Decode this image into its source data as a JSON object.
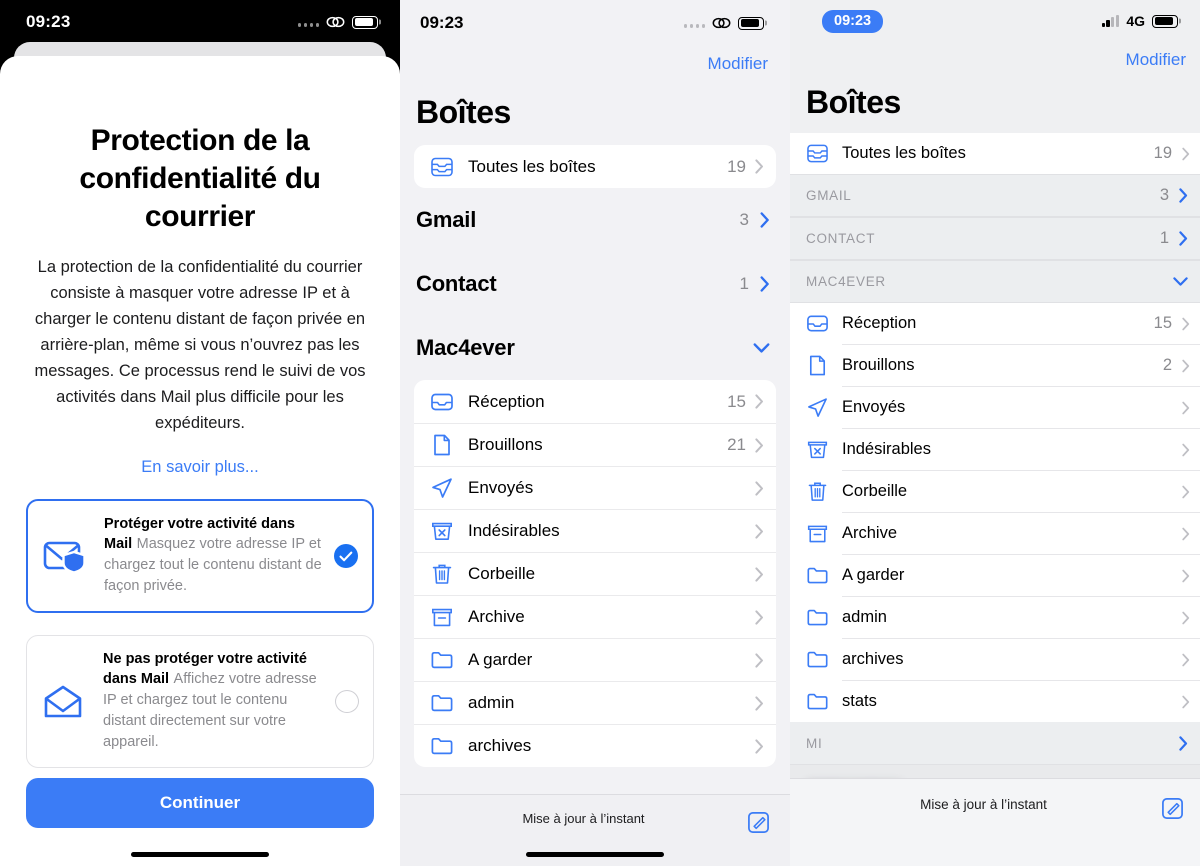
{
  "panel1": {
    "status": {
      "time": "09:23",
      "signal_icon": "signal-dots-icon",
      "link_icon": "chain-link-icon",
      "battery_icon": "battery-icon"
    },
    "title": "Protection de la confidentialité du courrier",
    "body": "La protection de la confidentialité du courrier consiste à masquer votre adresse IP et à charger le contenu distant de façon privée en arrière-plan, même si vous n’ouvrez pas les messages. Ce processus rend le suivi de vos activités dans Mail plus difficile pour les expéditeurs.",
    "learn_more": "En savoir plus...",
    "options": [
      {
        "icon": "envelope-shield-icon",
        "title": "Protéger votre activité dans Mail",
        "desc": "Masquez votre adresse IP et chargez tout le contenu distant de façon privée.",
        "selected": true
      },
      {
        "icon": "open-envelope-icon",
        "title": "Ne pas protéger votre activité dans Mail",
        "desc": "Affichez votre adresse IP et chargez tout le contenu distant directement sur votre appareil.",
        "selected": false
      }
    ],
    "continue_label": "Continuer",
    "accent_color": "#3b7cf6"
  },
  "panel2": {
    "status": {
      "time": "09:23",
      "signal_icon": "signal-dots-icon",
      "link_icon": "chain-link-icon",
      "battery_icon": "battery-icon"
    },
    "edit_label": "Modifier",
    "heading": "Boîtes",
    "all_boxes": {
      "icon": "all-inboxes-icon",
      "label": "Toutes les boîtes",
      "count": "19"
    },
    "accounts": [
      {
        "name": "Gmail",
        "count": "3",
        "chevron": "chevron-right-icon"
      },
      {
        "name": "Contact",
        "count": "1",
        "chevron": "chevron-right-icon"
      },
      {
        "name": "Mac4ever",
        "count": "",
        "chevron": "chevron-down-icon"
      }
    ],
    "mailboxes": [
      {
        "icon": "inbox-icon",
        "label": "Réception",
        "count": "15"
      },
      {
        "icon": "draft-icon",
        "label": "Brouillons",
        "count": "21"
      },
      {
        "icon": "sent-icon",
        "label": "Envoyés",
        "count": ""
      },
      {
        "icon": "junk-icon",
        "label": "Indésirables",
        "count": ""
      },
      {
        "icon": "trash-icon",
        "label": "Corbeille",
        "count": ""
      },
      {
        "icon": "archive-icon",
        "label": "Archive",
        "count": ""
      },
      {
        "icon": "folder-icon",
        "label": "A garder",
        "count": ""
      },
      {
        "icon": "folder-icon",
        "label": "admin",
        "count": ""
      },
      {
        "icon": "folder-icon",
        "label": "archives",
        "count": ""
      }
    ],
    "toolbar": {
      "status_text": "Mise à jour à l’instant",
      "compose_icon": "compose-icon"
    }
  },
  "panel3": {
    "status": {
      "time": "09:23",
      "signal_icon": "signal-bars-icon",
      "network": "4G",
      "battery_icon": "battery-icon"
    },
    "edit_label": "Modifier",
    "heading": "Boîtes",
    "all_boxes": {
      "icon": "all-inboxes-icon",
      "label": "Toutes les boîtes",
      "count": "19"
    },
    "sections": [
      {
        "label": "GMAIL",
        "count": "3",
        "chevron": "chevron-right-icon"
      },
      {
        "label": "CONTACT",
        "count": "1",
        "chevron": "chevron-right-icon"
      },
      {
        "label": "MAC4EVER",
        "count": "",
        "chevron": "chevron-down-icon"
      }
    ],
    "mailboxes": [
      {
        "icon": "inbox-icon",
        "label": "Réception",
        "count": "15"
      },
      {
        "icon": "draft-icon",
        "label": "Brouillons",
        "count": "2"
      },
      {
        "icon": "sent-icon",
        "label": "Envoyés",
        "count": ""
      },
      {
        "icon": "junk-icon",
        "label": "Indésirables",
        "count": ""
      },
      {
        "icon": "trash-icon",
        "label": "Corbeille",
        "count": ""
      },
      {
        "icon": "archive-icon",
        "label": "Archive",
        "count": ""
      },
      {
        "icon": "folder-icon",
        "label": "A garder",
        "count": ""
      },
      {
        "icon": "folder-icon",
        "label": "admin",
        "count": ""
      },
      {
        "icon": "folder-icon",
        "label": "archives",
        "count": ""
      },
      {
        "icon": "folder-icon",
        "label": "stats",
        "count": ""
      }
    ],
    "bottom_section": {
      "label": "MI",
      "count": "",
      "chevron": "chevron-right-icon"
    },
    "blurred_row": {
      "label": "",
      "chevron": "chevron-right-icon"
    },
    "toolbar": {
      "status_text": "Mise à jour à l’instant",
      "compose_icon": "compose-icon"
    }
  }
}
